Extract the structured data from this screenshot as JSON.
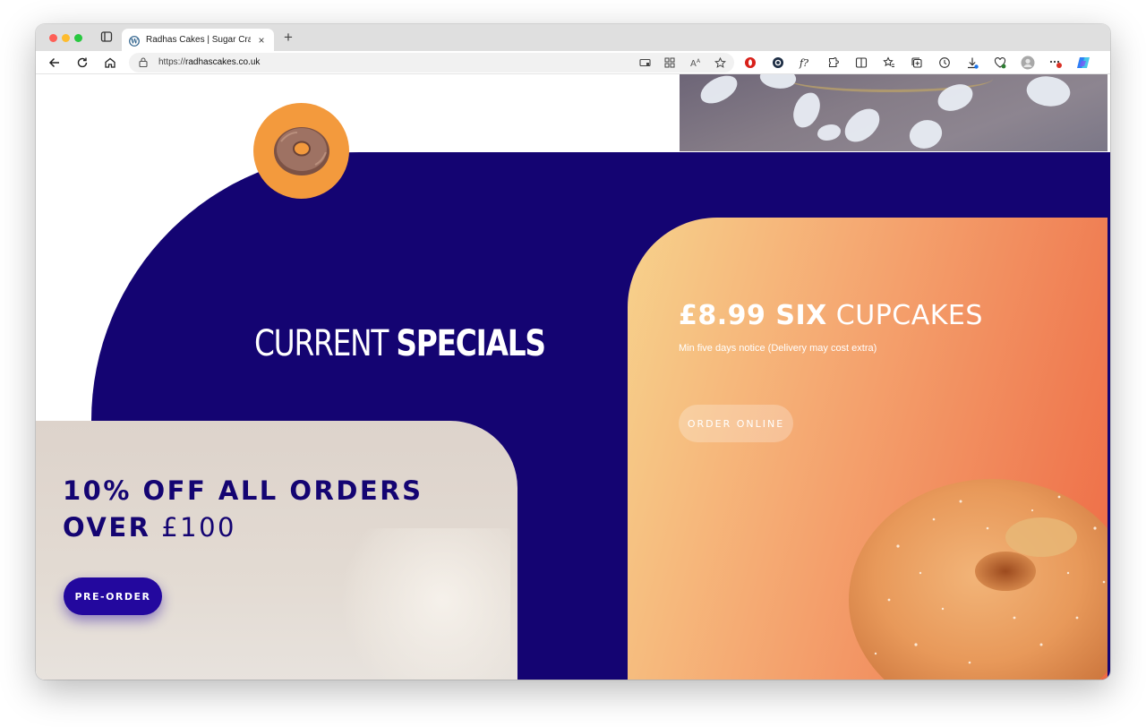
{
  "browser": {
    "tab_title": "Radhas Cakes | Sugar Craft & S",
    "url_scheme": "https://",
    "url_host": "radhascakes.co.uk",
    "new_tab_label": "+",
    "tab_close": "×"
  },
  "page": {
    "specials_heading_light": "CURRENT",
    "specials_heading_bold": "SPECIALS",
    "offer_line1": "10% OFF ALL ORDERS",
    "offer_line2_bold": "OVER",
    "offer_line2_light": "£100",
    "preorder_label": "PRE-ORDER",
    "price_bold": "£8.99 SIX",
    "price_light": "CUPCAKES",
    "price_notice": "Min five days notice (Delivery may cost extra)",
    "order_online_label": "ORDER ONLINE"
  },
  "colors": {
    "navy": "#140472",
    "button_blue": "#23089e",
    "orange_badge": "#f39a3d",
    "gradient_start": "#f7d28c",
    "gradient_end": "#ee6a44"
  },
  "icons": [
    "sidebar-icon",
    "wordpress-icon",
    "back-icon",
    "reload-icon",
    "home-icon",
    "lock-icon",
    "favorite-icon",
    "extensions-icon",
    "profile-icon",
    "copilot-icon"
  ]
}
